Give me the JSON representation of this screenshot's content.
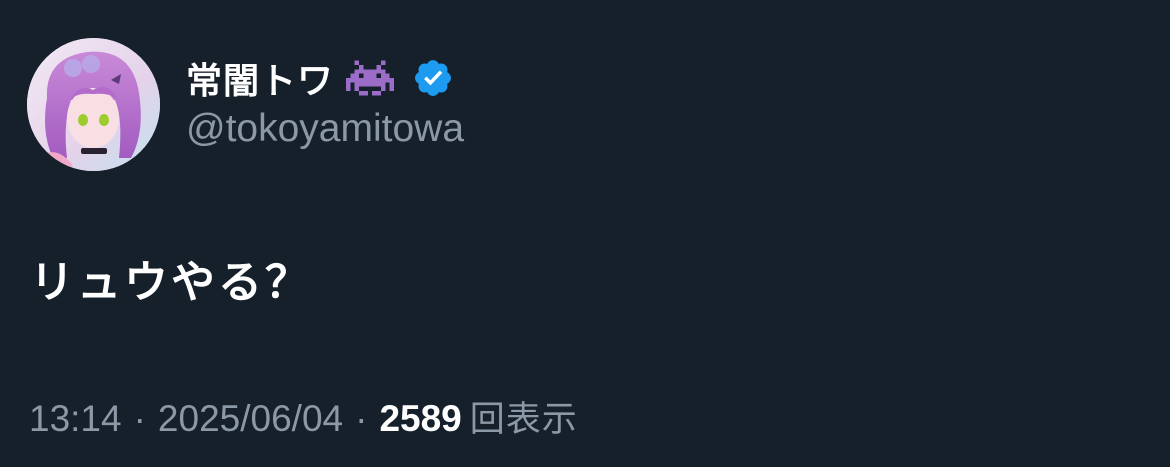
{
  "tweet": {
    "author": {
      "display_name": "常闇トワ",
      "name_emoji": "space-invader-alien-icon",
      "verified": true,
      "verified_color": "#1d9bf0",
      "handle": "@tokoyamitowa"
    },
    "text": "リュウやる？",
    "time": "13:14",
    "date": "2025/06/04",
    "separator": "·",
    "views_count": "2589",
    "views_label": "回表示"
  },
  "colors": {
    "background": "#15202b",
    "primary_text": "#ffffff",
    "secondary_text": "#8b98a5"
  }
}
